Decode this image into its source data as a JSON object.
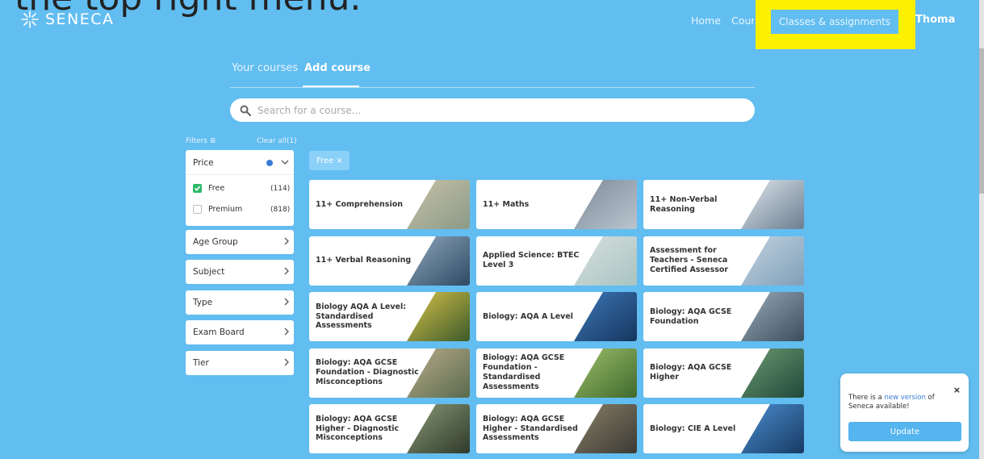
{
  "caption": "the top right menu.",
  "brand": {
    "name": "SENECA"
  },
  "nav": {
    "home": "Home",
    "courses": "Courses",
    "classes": "Classes & assignments",
    "user": "Thomas ▾"
  },
  "tabs": {
    "your_courses": "Your courses",
    "add_course": "Add course"
  },
  "search": {
    "placeholder": "Search for a course..."
  },
  "filters": {
    "label": "Filters ≣",
    "clear_all": "Clear all(1)",
    "price": {
      "label": "Price",
      "options": [
        {
          "label": "Free",
          "count": "(114)"
        },
        {
          "label": "Premium",
          "count": "(818)"
        }
      ]
    },
    "groups": [
      "Age Group",
      "Subject",
      "Type",
      "Exam Board",
      "Tier"
    ]
  },
  "active_filter": "Free ×",
  "courses": [
    "11+ Comprehension",
    "11+ Maths",
    "11+ Non-Verbal Reasoning",
    "11+ Verbal Reasoning",
    "Applied Science: BTEC Level 3",
    "Assessment for Teachers - Seneca Certified Assessor",
    "Biology AQA A Level: Standardised Assessments",
    "Biology: AQA A Level",
    "Biology: AQA GCSE Foundation",
    "Biology: AQA GCSE Foundation - Diagnostic Misconceptions",
    "Biology: AQA GCSE Foundation - Standardised Assessments",
    "Biology: AQA GCSE Higher",
    "Biology: AQA GCSE Higher - Diagnostic Misconceptions",
    "Biology: AQA GCSE Higher - Standardised Assessments",
    "Biology: CIE A Level"
  ],
  "toast": {
    "text_before": "There is a ",
    "link": "new version",
    "text_after": " of Seneca available!",
    "button": "Update",
    "close": "×"
  },
  "colors": {
    "background": "#62bdf0",
    "highlight": "#fdf000",
    "accent": "#54b5ef",
    "check": "#2fb86a"
  }
}
